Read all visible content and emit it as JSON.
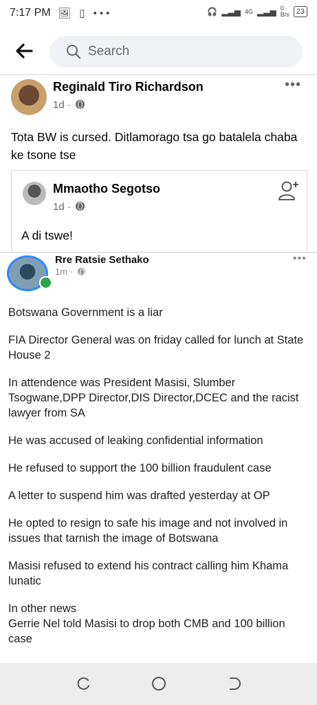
{
  "status_bar": {
    "time": "7:17 PM",
    "left_icons": "🖼 ▯ •••",
    "network": "4G",
    "speed": "0\nB/s",
    "battery": "23"
  },
  "header": {
    "search_placeholder": "Search"
  },
  "post": {
    "author": "Reginald Tiro Richardson",
    "time": "1d",
    "text": "Tota BW is cursed. Ditlamorago tsa go batalela chaba ke tsone tse"
  },
  "shared": {
    "author": "Mmaotho Segotso",
    "time": "1d",
    "text": "A di tswe!"
  },
  "screenshot": {
    "author": "Rre Ratsie Sethako",
    "time": "1m",
    "paragraphs": [
      "Botswana Government is a liar",
      "FIA Director General was on friday called for lunch at State House 2",
      "In attendence was President Masisi, Slumber Tsogwane,DPP Director,DIS Director,DCEC and the racist lawyer from SA",
      "He was accused of leaking confidential information",
      "He refused to support the 100 billion fraudulent case",
      "A letter to suspend him was drafted yesterday at OP",
      "He opted to resign to safe his image and not involved in issues that tarnish the image of Botswana",
      "Masisi refused to extend his contract calling him Khama lunatic",
      "In other news\nGerrie Nel told Masisi to drop both CMB and 100 billion case"
    ]
  }
}
